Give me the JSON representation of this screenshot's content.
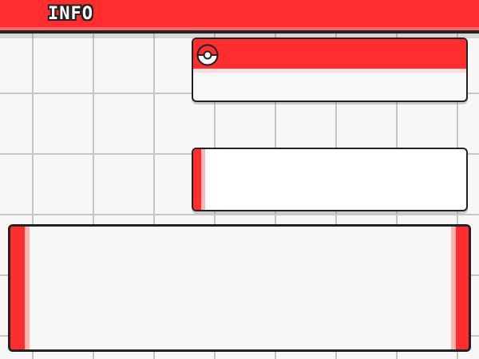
{
  "header": {
    "title": "INFO"
  },
  "colors": {
    "accent": "#ff2d2d",
    "accent_light": "#ffb3b3",
    "outline": "#222222",
    "panel": "#f8f8f8",
    "grid_line": "#c6c6c6"
  },
  "icons": {
    "pokeball": "pokeball-icon"
  }
}
